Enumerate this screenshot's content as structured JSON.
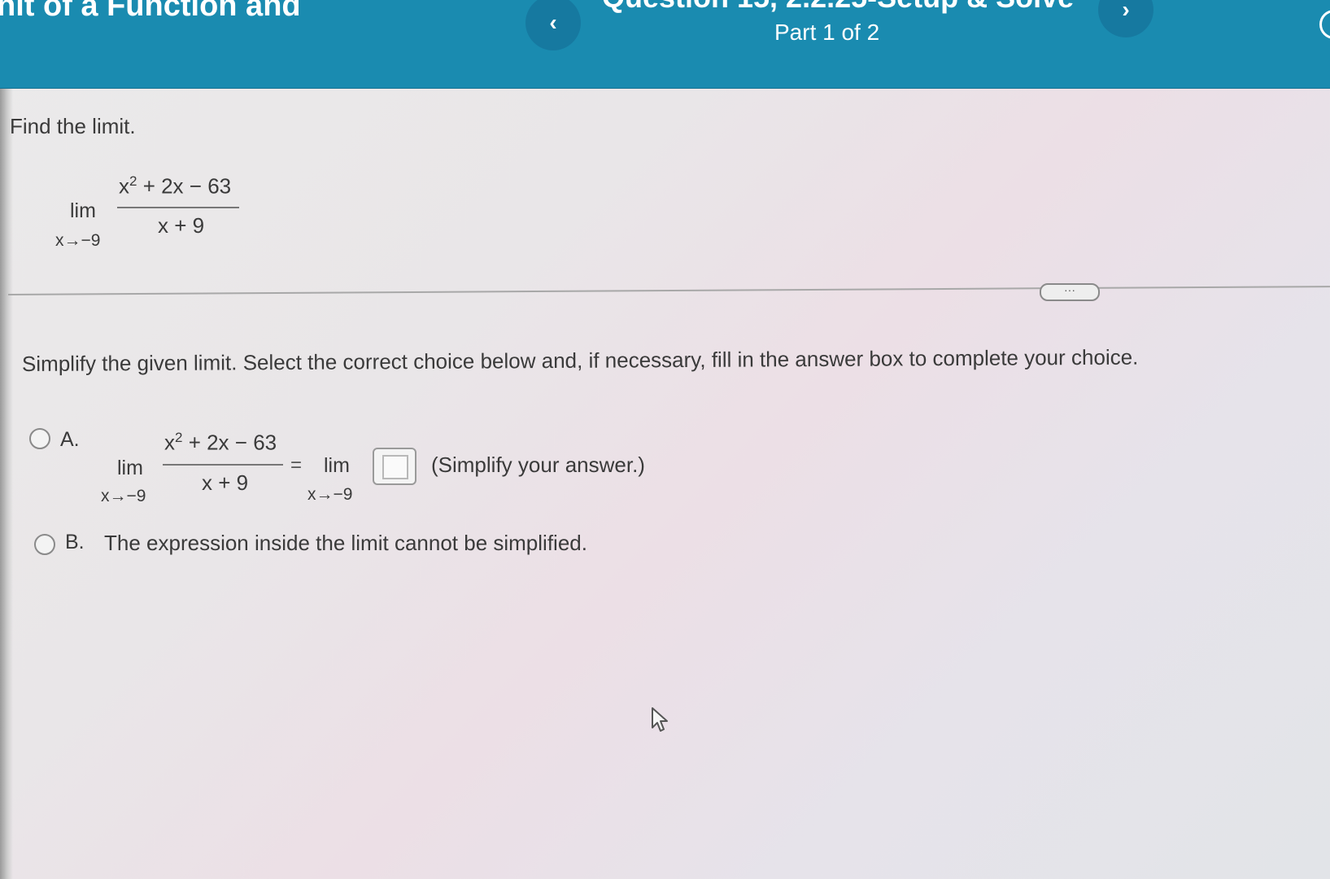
{
  "header": {
    "title": "nit of a Function and",
    "question": "Question 15, 2.2.25-Setup & Solve",
    "part": "Part 1 of 2",
    "prev_icon": "‹",
    "next_icon": "›"
  },
  "problem": {
    "prompt": "Find the limit.",
    "lim": "lim",
    "approach": "x→−9",
    "numerator": "x",
    "numerator_exp": "2",
    "numerator_rest": " + 2x − 63",
    "denominator": "x + 9"
  },
  "more_button": "···",
  "instruction": "Simplify the given limit. Select the correct choice below and, if necessary, fill in the answer box to complete your choice.",
  "choices": {
    "a": {
      "letter": "A.",
      "lim": "lim",
      "approach": "x→−9",
      "numerator": "x",
      "numerator_exp": "2",
      "numerator_rest": " + 2x − 63",
      "denominator": "x + 9",
      "equals": "=",
      "rhs_lim": "lim",
      "rhs_approach": "x→−9",
      "note": "(Simplify your answer.)"
    },
    "b": {
      "letter": "B.",
      "text": "The expression inside the limit cannot be simplified."
    }
  }
}
